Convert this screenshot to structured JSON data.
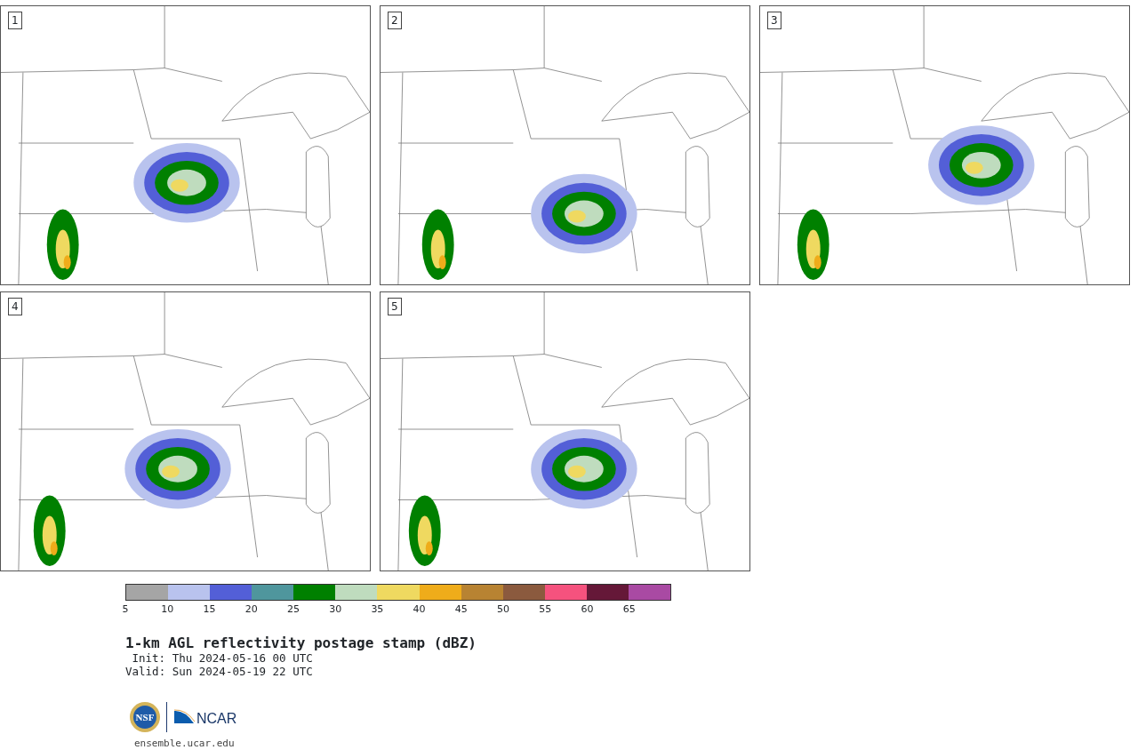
{
  "panels": [
    {
      "number": "1"
    },
    {
      "number": "2"
    },
    {
      "number": "3"
    },
    {
      "number": "4"
    },
    {
      "number": "5"
    }
  ],
  "colorbar": {
    "bins": [
      {
        "color": "#a5a5a5"
      },
      {
        "color": "#b9c3ee"
      },
      {
        "color": "#535fd7"
      },
      {
        "color": "#4f969d"
      },
      {
        "color": "#008000"
      },
      {
        "color": "#bfdcbe"
      },
      {
        "color": "#efd960"
      },
      {
        "color": "#efac1a"
      },
      {
        "color": "#b88332"
      },
      {
        "color": "#8b5a3e"
      },
      {
        "color": "#f5527e"
      },
      {
        "color": "#651838"
      },
      {
        "color": "#a94aa3"
      }
    ],
    "ticks": [
      "5",
      "10",
      "15",
      "20",
      "25",
      "30",
      "35",
      "40",
      "45",
      "50",
      "55",
      "60",
      "65"
    ]
  },
  "title": "1-km AGL reflectivity postage stamp (dBZ)",
  "init": "Init: Thu 2024-05-16 00 UTC",
  "valid": "Valid: Sun 2024-05-19 22 UTC",
  "logos": {
    "nsf": "NSF",
    "ncar": "NCAR"
  },
  "footer": "ensemble.ucar.edu"
}
